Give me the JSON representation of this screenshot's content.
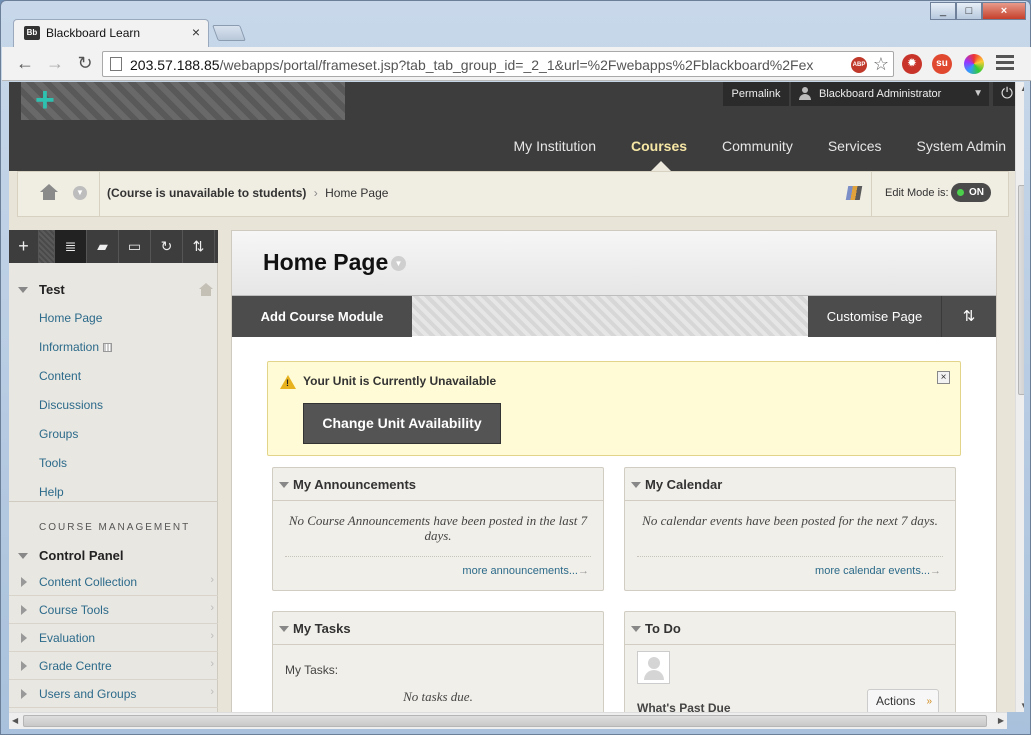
{
  "browser": {
    "tab_title": "Blackboard Learn",
    "tab_favicon": "Bb",
    "tab_close": "×",
    "url_host": "203.57.188.85",
    "url_path": "/webapps/portal/frameset.jsp?tab_tab_group_id=_2_1&url=%2Fwebapps%2Fblackboard%2Fex",
    "adblock_label": "ABP",
    "window_buttons": [
      "_",
      "□",
      "×"
    ]
  },
  "header": {
    "permalink": "Permalink",
    "user_name": "Blackboard Administrator",
    "nav": [
      {
        "label": "My Institution",
        "active": false
      },
      {
        "label": "Courses",
        "active": true
      },
      {
        "label": "Community",
        "active": false
      },
      {
        "label": "Services",
        "active": false
      },
      {
        "label": "System Admin",
        "active": false
      }
    ]
  },
  "breadcrumb": {
    "course_status": "(Course is unavailable to students)",
    "separator": "›",
    "current": "Home Page",
    "edit_mode_label": "Edit Mode is:",
    "edit_mode_value": "ON"
  },
  "course_menu": {
    "tools": [
      "+",
      "≣",
      "▰",
      "▭",
      "↻",
      "⇅"
    ],
    "course_title": "Test",
    "links": [
      "Home Page",
      "Information",
      "Content",
      "Discussions",
      "Groups",
      "Tools",
      "Help"
    ],
    "management_heading": "COURSE MANAGEMENT",
    "control_panel": "Control Panel",
    "control_panel_items": [
      "Content Collection",
      "Course Tools",
      "Evaluation",
      "Grade Centre",
      "Users and Groups"
    ]
  },
  "content": {
    "page_title": "Home Page",
    "add_module": "Add Course Module",
    "customise": "Customise Page",
    "reorder_icon": "⇅",
    "alert": {
      "message": "Your Unit is Currently Unavailable",
      "button": "Change Unit Availability",
      "close": "×"
    },
    "modules": {
      "announcements": {
        "title": "My Announcements",
        "empty": "No Course Announcements have been posted in the last 7 days.",
        "more": "more announcements..."
      },
      "calendar": {
        "title": "My Calendar",
        "empty": "No calendar events have been posted for the next 7 days.",
        "more": "more calendar events..."
      },
      "tasks": {
        "title": "My Tasks",
        "label": "My Tasks:",
        "empty": "No tasks due."
      },
      "todo": {
        "title": "To Do",
        "past_due": "What's Past Due",
        "actions": "Actions"
      }
    }
  },
  "colors": {
    "header_bg": "#3d3d3d",
    "active_nav": "#f7e7a5",
    "link": "#2b6a8a",
    "alert_bg": "#fffbd6",
    "logo_accent": "#2fc1b0"
  }
}
